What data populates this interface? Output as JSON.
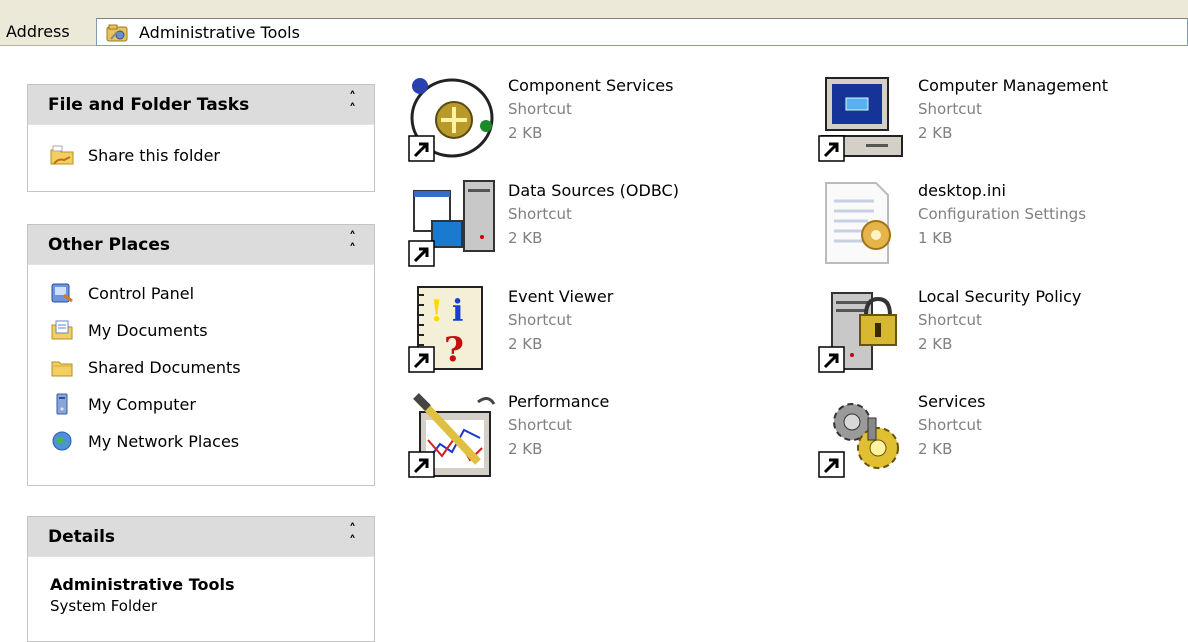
{
  "address": {
    "label": "Address",
    "value": "Administrative Tools",
    "icon": "admin-tools-icon"
  },
  "panels": {
    "tasks": {
      "title": "File and Folder Tasks",
      "items": [
        {
          "label": "Share this folder",
          "icon": "share-folder-icon"
        }
      ]
    },
    "other": {
      "title": "Other Places",
      "items": [
        {
          "label": "Control Panel",
          "icon": "control-panel-icon"
        },
        {
          "label": "My Documents",
          "icon": "my-documents-icon"
        },
        {
          "label": "Shared Documents",
          "icon": "shared-documents-icon"
        },
        {
          "label": "My Computer",
          "icon": "my-computer-icon"
        },
        {
          "label": "My Network Places",
          "icon": "network-places-icon"
        }
      ]
    },
    "details": {
      "title": "Details",
      "name": "Administrative Tools",
      "type": "System Folder"
    }
  },
  "files": [
    {
      "name": "Component Services",
      "type": "Shortcut",
      "size": "2 KB",
      "icon": "component-services-icon"
    },
    {
      "name": "Computer Management",
      "type": "Shortcut",
      "size": "2 KB",
      "icon": "computer-management-icon"
    },
    {
      "name": "Data Sources (ODBC)",
      "type": "Shortcut",
      "size": "2 KB",
      "icon": "data-sources-icon"
    },
    {
      "name": "desktop.ini",
      "type": "Configuration Settings",
      "size": "1 KB",
      "icon": "config-file-icon"
    },
    {
      "name": "Event Viewer",
      "type": "Shortcut",
      "size": "2 KB",
      "icon": "event-viewer-icon"
    },
    {
      "name": "Local Security Policy",
      "type": "Shortcut",
      "size": "2 KB",
      "icon": "security-policy-icon"
    },
    {
      "name": "Performance",
      "type": "Shortcut",
      "size": "2 KB",
      "icon": "performance-icon"
    },
    {
      "name": "Services",
      "type": "Shortcut",
      "size": "2 KB",
      "icon": "services-icon"
    }
  ]
}
